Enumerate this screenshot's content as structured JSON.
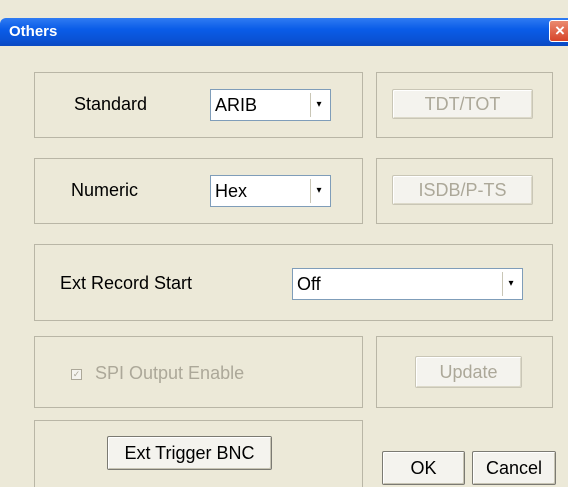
{
  "window": {
    "title": "Others",
    "close_glyph": "×"
  },
  "standard": {
    "label": "Standard",
    "value": "ARIB",
    "arrow_glyph": "▾"
  },
  "numeric": {
    "label": "Numeric",
    "value": "Hex",
    "arrow_glyph": "▾"
  },
  "ext_record": {
    "label": "Ext Record Start",
    "value": "Off",
    "arrow_glyph": "▾"
  },
  "spi": {
    "label": "SPI Output Enable",
    "checked_glyph": "✓",
    "checked": true,
    "enabled": false
  },
  "buttons": {
    "tdt_tot": "TDT/TOT",
    "isdb_pts": "ISDB/P-TS",
    "update": "Update",
    "ext_trigger": "Ext Trigger BNC",
    "ok": "OK",
    "cancel": "Cancel"
  },
  "colors": {
    "title_bar": "#0a5ce8",
    "dialog_bg": "#ece9d8",
    "disabled_text": "#aca899",
    "close_button": "#d7452a"
  },
  "icons": {
    "close": "close-icon",
    "dropdown": "chevron-down-icon",
    "check": "check-icon"
  }
}
